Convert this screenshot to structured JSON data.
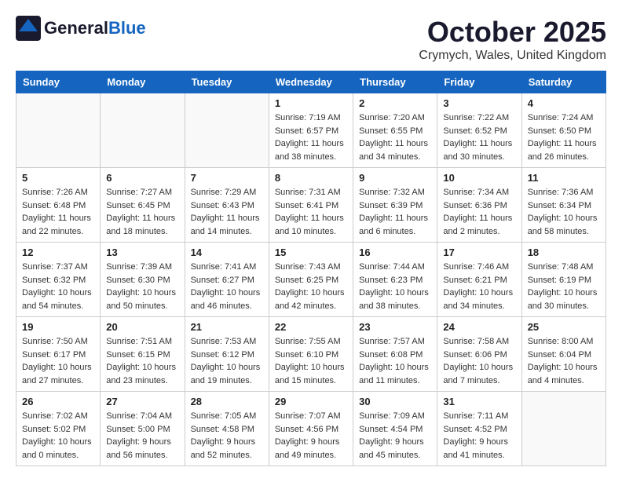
{
  "header": {
    "logo_general": "General",
    "logo_blue": "Blue",
    "month_title": "October 2025",
    "location": "Crymych, Wales, United Kingdom"
  },
  "calendar": {
    "days_of_week": [
      "Sunday",
      "Monday",
      "Tuesday",
      "Wednesday",
      "Thursday",
      "Friday",
      "Saturday"
    ],
    "weeks": [
      [
        {
          "day": "",
          "info": ""
        },
        {
          "day": "",
          "info": ""
        },
        {
          "day": "",
          "info": ""
        },
        {
          "day": "1",
          "info": "Sunrise: 7:19 AM\nSunset: 6:57 PM\nDaylight: 11 hours and 38 minutes."
        },
        {
          "day": "2",
          "info": "Sunrise: 7:20 AM\nSunset: 6:55 PM\nDaylight: 11 hours and 34 minutes."
        },
        {
          "day": "3",
          "info": "Sunrise: 7:22 AM\nSunset: 6:52 PM\nDaylight: 11 hours and 30 minutes."
        },
        {
          "day": "4",
          "info": "Sunrise: 7:24 AM\nSunset: 6:50 PM\nDaylight: 11 hours and 26 minutes."
        }
      ],
      [
        {
          "day": "5",
          "info": "Sunrise: 7:26 AM\nSunset: 6:48 PM\nDaylight: 11 hours and 22 minutes."
        },
        {
          "day": "6",
          "info": "Sunrise: 7:27 AM\nSunset: 6:45 PM\nDaylight: 11 hours and 18 minutes."
        },
        {
          "day": "7",
          "info": "Sunrise: 7:29 AM\nSunset: 6:43 PM\nDaylight: 11 hours and 14 minutes."
        },
        {
          "day": "8",
          "info": "Sunrise: 7:31 AM\nSunset: 6:41 PM\nDaylight: 11 hours and 10 minutes."
        },
        {
          "day": "9",
          "info": "Sunrise: 7:32 AM\nSunset: 6:39 PM\nDaylight: 11 hours and 6 minutes."
        },
        {
          "day": "10",
          "info": "Sunrise: 7:34 AM\nSunset: 6:36 PM\nDaylight: 11 hours and 2 minutes."
        },
        {
          "day": "11",
          "info": "Sunrise: 7:36 AM\nSunset: 6:34 PM\nDaylight: 10 hours and 58 minutes."
        }
      ],
      [
        {
          "day": "12",
          "info": "Sunrise: 7:37 AM\nSunset: 6:32 PM\nDaylight: 10 hours and 54 minutes."
        },
        {
          "day": "13",
          "info": "Sunrise: 7:39 AM\nSunset: 6:30 PM\nDaylight: 10 hours and 50 minutes."
        },
        {
          "day": "14",
          "info": "Sunrise: 7:41 AM\nSunset: 6:27 PM\nDaylight: 10 hours and 46 minutes."
        },
        {
          "day": "15",
          "info": "Sunrise: 7:43 AM\nSunset: 6:25 PM\nDaylight: 10 hours and 42 minutes."
        },
        {
          "day": "16",
          "info": "Sunrise: 7:44 AM\nSunset: 6:23 PM\nDaylight: 10 hours and 38 minutes."
        },
        {
          "day": "17",
          "info": "Sunrise: 7:46 AM\nSunset: 6:21 PM\nDaylight: 10 hours and 34 minutes."
        },
        {
          "day": "18",
          "info": "Sunrise: 7:48 AM\nSunset: 6:19 PM\nDaylight: 10 hours and 30 minutes."
        }
      ],
      [
        {
          "day": "19",
          "info": "Sunrise: 7:50 AM\nSunset: 6:17 PM\nDaylight: 10 hours and 27 minutes."
        },
        {
          "day": "20",
          "info": "Sunrise: 7:51 AM\nSunset: 6:15 PM\nDaylight: 10 hours and 23 minutes."
        },
        {
          "day": "21",
          "info": "Sunrise: 7:53 AM\nSunset: 6:12 PM\nDaylight: 10 hours and 19 minutes."
        },
        {
          "day": "22",
          "info": "Sunrise: 7:55 AM\nSunset: 6:10 PM\nDaylight: 10 hours and 15 minutes."
        },
        {
          "day": "23",
          "info": "Sunrise: 7:57 AM\nSunset: 6:08 PM\nDaylight: 10 hours and 11 minutes."
        },
        {
          "day": "24",
          "info": "Sunrise: 7:58 AM\nSunset: 6:06 PM\nDaylight: 10 hours and 7 minutes."
        },
        {
          "day": "25",
          "info": "Sunrise: 8:00 AM\nSunset: 6:04 PM\nDaylight: 10 hours and 4 minutes."
        }
      ],
      [
        {
          "day": "26",
          "info": "Sunrise: 7:02 AM\nSunset: 5:02 PM\nDaylight: 10 hours and 0 minutes."
        },
        {
          "day": "27",
          "info": "Sunrise: 7:04 AM\nSunset: 5:00 PM\nDaylight: 9 hours and 56 minutes."
        },
        {
          "day": "28",
          "info": "Sunrise: 7:05 AM\nSunset: 4:58 PM\nDaylight: 9 hours and 52 minutes."
        },
        {
          "day": "29",
          "info": "Sunrise: 7:07 AM\nSunset: 4:56 PM\nDaylight: 9 hours and 49 minutes."
        },
        {
          "day": "30",
          "info": "Sunrise: 7:09 AM\nSunset: 4:54 PM\nDaylight: 9 hours and 45 minutes."
        },
        {
          "day": "31",
          "info": "Sunrise: 7:11 AM\nSunset: 4:52 PM\nDaylight: 9 hours and 41 minutes."
        },
        {
          "day": "",
          "info": ""
        }
      ]
    ]
  }
}
